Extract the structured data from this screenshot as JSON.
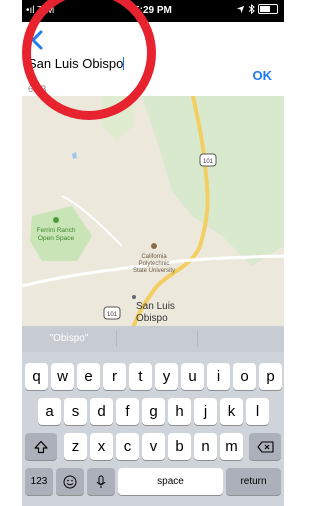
{
  "status_bar": {
    "carrier": "•ıl T-M",
    "time": "5:29 PM",
    "icons": [
      "wifi-icon",
      "location-icon",
      "bluetooth-icon",
      "battery-icon"
    ]
  },
  "nav": {
    "title_value": "San Luis Obispo",
    "ok_label": "OK",
    "size_label": "6MB"
  },
  "map": {
    "labels": {
      "highway_1": "101",
      "highway_2": "101",
      "ferrini_line1": "Ferrini Ranch",
      "ferrini_line2": "Open Space",
      "cal_line1": "California",
      "cal_line2": "Polytechnic",
      "cal_line3": "State University",
      "city_line1": "San Luis",
      "city_line2": "Obispo"
    }
  },
  "keyboard": {
    "suggestions": [
      "\"Obispo\"",
      "",
      ""
    ],
    "row1": [
      "q",
      "w",
      "e",
      "r",
      "t",
      "y",
      "u",
      "i",
      "o",
      "p"
    ],
    "row2": [
      "a",
      "s",
      "d",
      "f",
      "g",
      "h",
      "j",
      "k",
      "l"
    ],
    "row3": [
      "z",
      "x",
      "c",
      "v",
      "b",
      "n",
      "m"
    ],
    "numbers_label": "123",
    "space_label": "space",
    "return_label": "return"
  },
  "colors": {
    "accent": "#1e7cf2",
    "annotation": "#e6232e",
    "keyboard_bg": "#cfd3da",
    "road": "#f3cf63",
    "park": "#c9e4b6"
  }
}
